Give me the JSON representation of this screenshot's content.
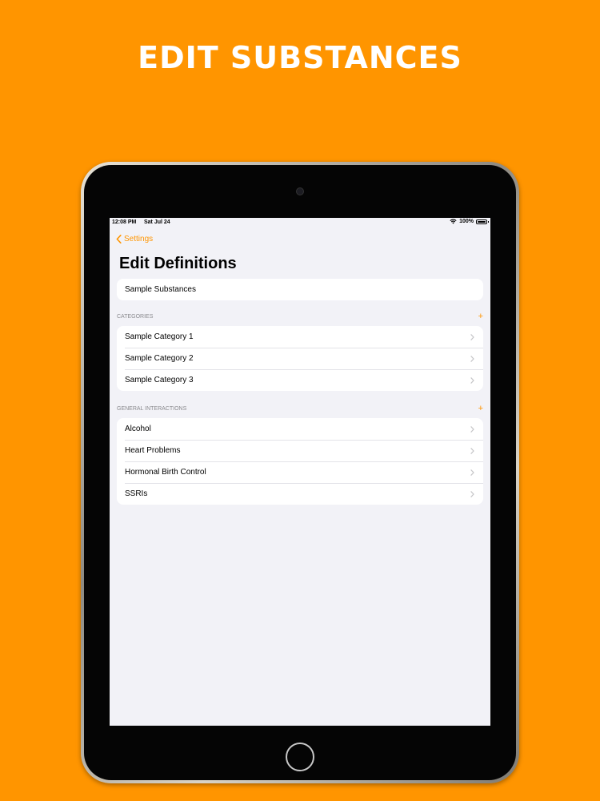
{
  "headline": "EDIT SUBSTANCES",
  "status_bar": {
    "time": "12:08 PM",
    "date": "Sat Jul 24",
    "battery": "100%"
  },
  "nav": {
    "back_label": "Settings",
    "title": "Edit Definitions"
  },
  "substances_row": "Sample Substances",
  "categories": {
    "header": "CATEGORIES",
    "add_label": "+",
    "items": [
      "Sample Category 1",
      "Sample Category 2",
      "Sample Category 3"
    ]
  },
  "interactions": {
    "header": "GENERAL INTERACTIONS",
    "add_label": "+",
    "items": [
      "Alcohol",
      "Heart Problems",
      "Hormonal Birth Control",
      "SSRIs"
    ]
  },
  "colors": {
    "accent": "#FF9500",
    "background": "#FF9500",
    "screen_bg": "#F2F2F7"
  }
}
